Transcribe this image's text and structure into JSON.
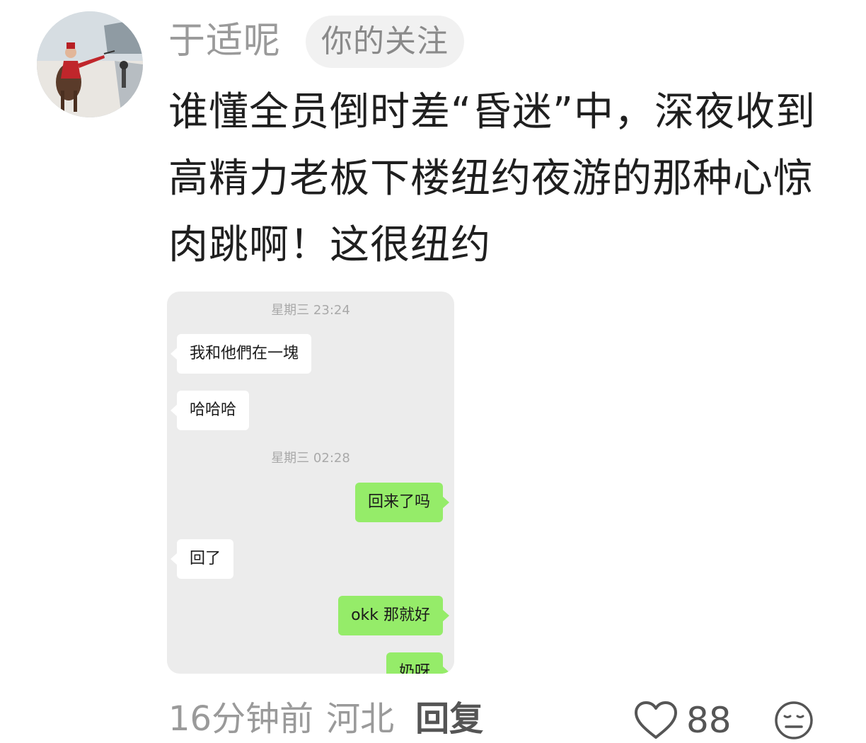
{
  "comment": {
    "username": "于适呢",
    "badge": "你的关注",
    "text": "谁懂全员倒时差“昏迷”中，深夜收到高精力老板下楼纽约夜游的那种心惊肉跳啊！这很纽约",
    "footer": {
      "time_ago": "16分钟前",
      "region": "河北",
      "reply_label": "回复",
      "like_count": "88"
    },
    "icons": {
      "like": "heart-outline-icon",
      "emoji": "expressionless-face-icon"
    }
  },
  "chat": {
    "messages": [
      {
        "type": "time",
        "text": "星期三 23:24"
      },
      {
        "type": "in",
        "text": "我和他們在一塊"
      },
      {
        "type": "in",
        "text": "哈哈哈"
      },
      {
        "type": "time",
        "text": "星期三 02:28"
      },
      {
        "type": "out",
        "text": "回来了吗"
      },
      {
        "type": "in",
        "text": "回了"
      },
      {
        "type": "out",
        "text": "okk 那就好"
      },
      {
        "type": "out",
        "text": "奶呀"
      }
    ],
    "colors": {
      "background": "#ececec",
      "incoming": "#ffffff",
      "outgoing": "#95ec69"
    }
  }
}
